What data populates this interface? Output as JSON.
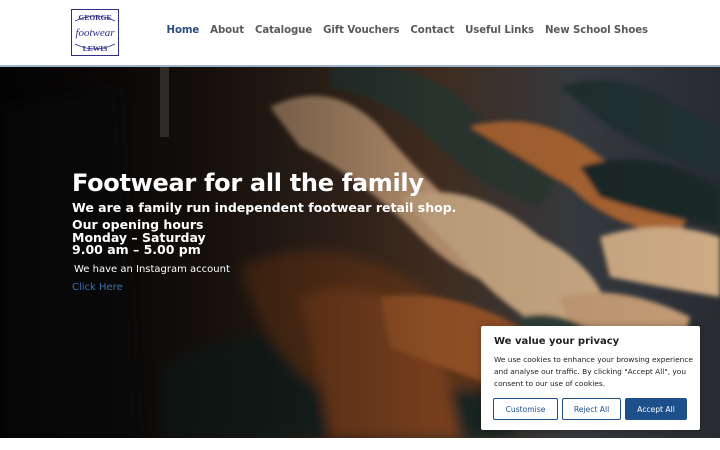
{
  "header": {
    "logo": {
      "line1": "GEORGE",
      "line2": "footwear",
      "line3": "LEWIS"
    },
    "nav": [
      {
        "label": "Home",
        "active": true
      },
      {
        "label": "About",
        "active": false
      },
      {
        "label": "Catalogue",
        "active": false
      },
      {
        "label": "Gift Vouchers",
        "active": false
      },
      {
        "label": "Contact",
        "active": false
      },
      {
        "label": "Useful Links",
        "active": false
      },
      {
        "label": "New School Shoes",
        "active": false
      }
    ]
  },
  "hero": {
    "title": "Footwear for all the family",
    "subtitle": "We are a family run independent footwear retail shop.",
    "hours_title": "Our opening hours",
    "hours_days": "Monday – Saturday",
    "hours_time": "9.00 am – 5.00 pm",
    "instagram_text": "We have an Instagram account",
    "instagram_link": "Click Here"
  },
  "cookie_banner": {
    "title": "We value your privacy",
    "text": "We use cookies to enhance your browsing experience and analyse our traffic. By clicking \"Accept All\", you consent to our use of cookies.",
    "customise_label": "Customise",
    "reject_label": "Reject All",
    "accept_label": "Accept All"
  },
  "colors": {
    "nav_active": "#2d4d7c",
    "nav_text": "#5a5a5a",
    "link": "#3f6fb0",
    "button_primary": "#1d4f8a",
    "logo": "#2c2e8a"
  }
}
